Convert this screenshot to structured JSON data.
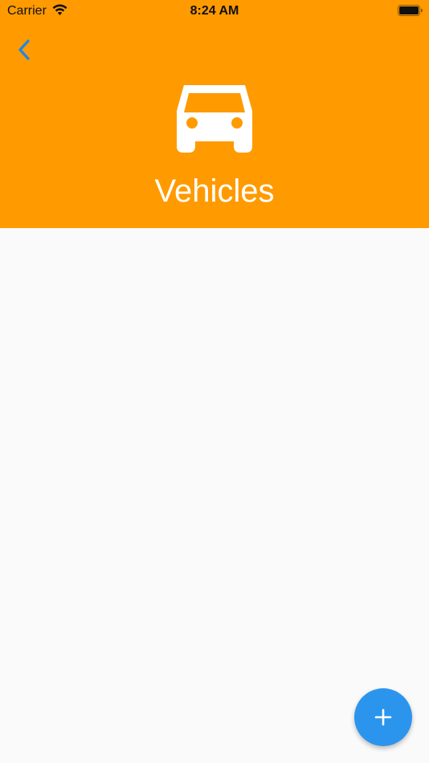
{
  "status_bar": {
    "carrier": "Carrier",
    "time": "8:24 AM",
    "wifi_icon": "wifi-icon",
    "battery_icon": "battery-icon"
  },
  "header": {
    "back_icon": "chevron-left-icon",
    "title_icon": "car-icon",
    "title": "Vehicles"
  },
  "fab": {
    "icon": "plus-icon"
  },
  "colors": {
    "header_bg": "#ff9a00",
    "accent_blue": "#2b95ee",
    "content_bg": "#fafafa",
    "title_text": "#ffffff"
  }
}
